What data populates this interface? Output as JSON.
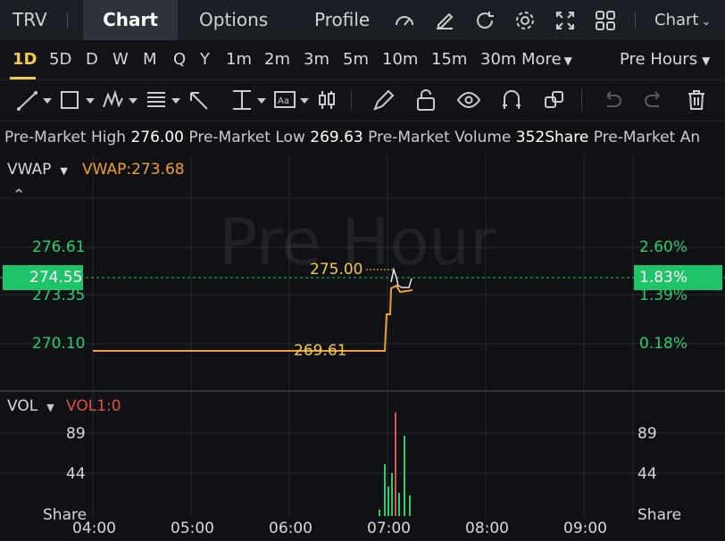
{
  "header": {
    "symbol": "TRV",
    "tabs": [
      "Chart",
      "Options",
      "Profile"
    ],
    "chart_menu": "Chart"
  },
  "timeframes": [
    "1D",
    "5D",
    "D",
    "W",
    "M",
    "Q",
    "Y",
    "1m",
    "2m",
    "3m",
    "5m",
    "10m",
    "15m",
    "30m"
  ],
  "more_label": "More",
  "session": "Pre Hours",
  "info": {
    "high_label": "Pre-Market High",
    "high_value": "276.00",
    "low_label": "Pre-Market Low",
    "low_value": "269.63",
    "vol_label": "Pre-Market Volume",
    "vol_value": "352Share",
    "trailing": "Pre-Market An"
  },
  "main": {
    "indicator": "VWAP",
    "vwap_value": "VWAP:273.68",
    "watermark": "Pre Hour",
    "left_ticks": [
      "276.61",
      "273.35",
      "270.10"
    ],
    "current_price": "274.55",
    "right_ticks": [
      "2.60%",
      "1.39%",
      "0.18%"
    ],
    "current_pct": "1.83%",
    "high_marker": "275.00",
    "low_marker": "269.61"
  },
  "volume": {
    "indicator": "VOL",
    "vol_value": "VOL1:0",
    "ticks": [
      "89",
      "44"
    ],
    "unit": "Share",
    "right_ticks": [
      "89",
      "44"
    ],
    "right_unit": "Share"
  },
  "x_axis": [
    "04:00",
    "05:00",
    "06:00",
    "07:00",
    "08:00",
    "09:00"
  ],
  "colors": {
    "accent": "#f2c94c",
    "up": "#2ecc71",
    "down": "#e0504a",
    "vwap": "#f0a030",
    "badge": "#1fc46a"
  }
}
